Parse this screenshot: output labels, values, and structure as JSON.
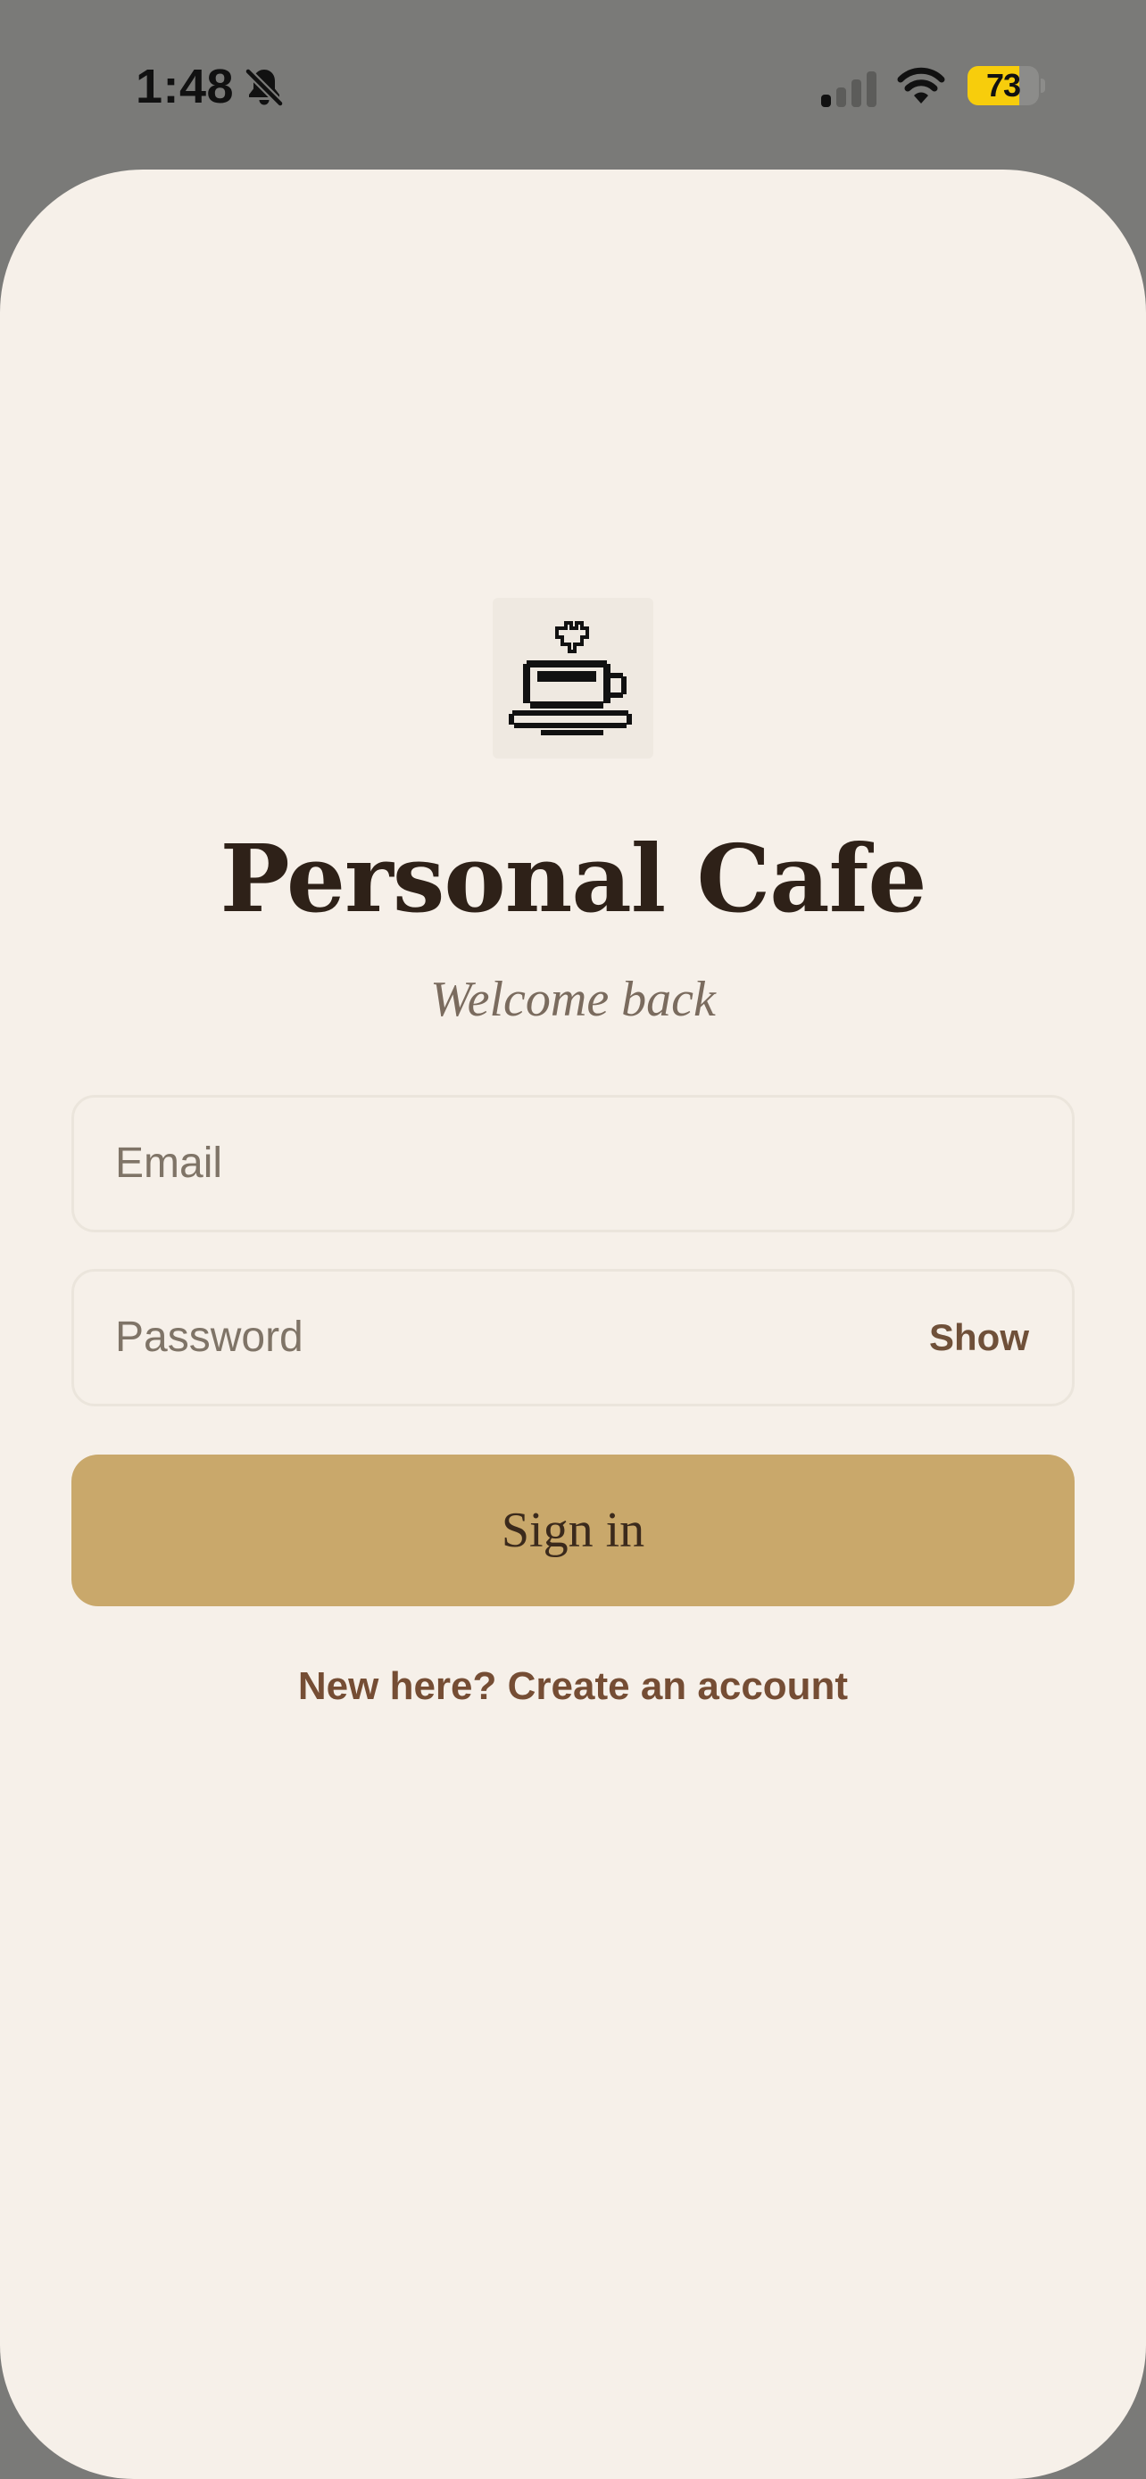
{
  "status_bar": {
    "time": "1:48",
    "battery_percent": "73",
    "battery_level": 0.73,
    "icons": [
      "bell-slash-icon",
      "cellular-signal-icon",
      "wifi-icon",
      "battery-icon"
    ],
    "battery_color": "#f7cd0c"
  },
  "logo": {
    "icon": "coffee-cup-icon"
  },
  "app": {
    "title": "Personal Cafe",
    "subtitle": "Welcome back"
  },
  "form": {
    "email": {
      "value": "",
      "placeholder": "Email"
    },
    "password": {
      "value": "",
      "placeholder": "Password",
      "toggle_label": "Show"
    },
    "submit_label": "Sign in",
    "create_account_label": "New here? Create an account"
  },
  "colors": {
    "background": "#f6f0e9",
    "accent": "#c9a86b",
    "link": "#754d34",
    "title": "#2e2118"
  }
}
